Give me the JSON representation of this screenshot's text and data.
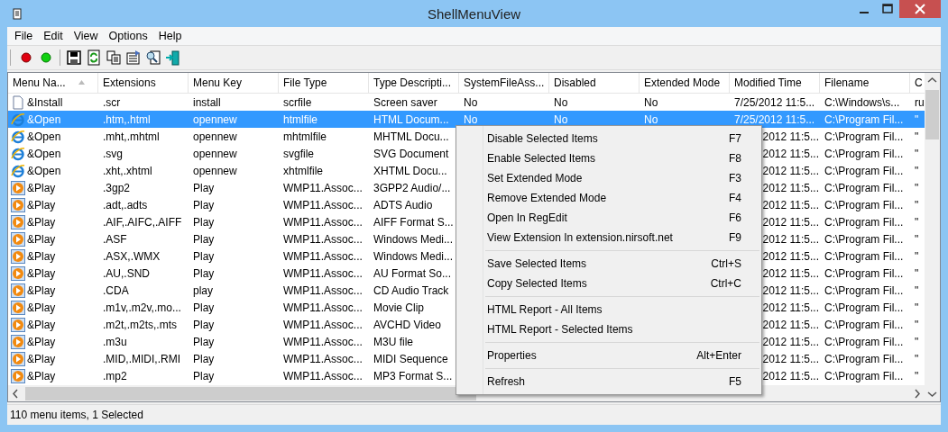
{
  "window": {
    "title": "ShellMenuView"
  },
  "menubar": [
    "File",
    "Edit",
    "View",
    "Options",
    "Help"
  ],
  "columns": [
    {
      "label": "Menu Na...",
      "sorted": true
    },
    {
      "label": "Extensions",
      "sorted": false
    },
    {
      "label": "Menu Key",
      "sorted": false
    },
    {
      "label": "File Type",
      "sorted": false
    },
    {
      "label": "Type Descripti...",
      "sorted": false
    },
    {
      "label": "SystemFileAss...",
      "sorted": false
    },
    {
      "label": "Disabled",
      "sorted": false
    },
    {
      "label": "Extended Mode",
      "sorted": false
    },
    {
      "label": "Modified Time",
      "sorted": false
    },
    {
      "label": "Filename",
      "sorted": false
    },
    {
      "label": "C",
      "sorted": false
    }
  ],
  "rows": [
    {
      "kind": "document",
      "selected": false,
      "name": "&Install",
      "extensions": ".scr",
      "menu_key": "install",
      "file_type": "scrfile",
      "type_description": "Screen saver",
      "system_file_association": "No",
      "disabled": "No",
      "extended_mode": "No",
      "modified_time": "7/25/2012 11:5...",
      "filename": "C:\\Windows\\s...",
      "column_10": "ru"
    },
    {
      "kind": "browser",
      "selected": true,
      "name": "&Open",
      "extensions": ".htm,.html",
      "menu_key": "opennew",
      "file_type": "htmlfile",
      "type_description": "HTML Docum...",
      "system_file_association": "No",
      "disabled": "No",
      "extended_mode": "No",
      "modified_time": "7/25/2012 11:5...",
      "filename": "C:\\Program Fil...",
      "column_10": "\""
    },
    {
      "kind": "browser",
      "selected": false,
      "name": "&Open",
      "extensions": ".mht,.mhtml",
      "menu_key": "opennew",
      "file_type": "mhtmlfile",
      "type_description": "MHTML Docu...",
      "modified_time": "2012 11:5...",
      "filename": "C:\\Program Fil...",
      "column_10": "\""
    },
    {
      "kind": "browser",
      "selected": false,
      "name": "&Open",
      "extensions": ".svg",
      "menu_key": "opennew",
      "file_type": "svgfile",
      "type_description": "SVG Document",
      "modified_time": "2012 11:5...",
      "filename": "C:\\Program Fil...",
      "column_10": "\""
    },
    {
      "kind": "browser",
      "selected": false,
      "name": "&Open",
      "extensions": ".xht,.xhtml",
      "menu_key": "opennew",
      "file_type": "xhtmlfile",
      "type_description": "XHTML Docu...",
      "modified_time": "2012 11:5...",
      "filename": "C:\\Program Fil...",
      "column_10": "\""
    },
    {
      "kind": "play",
      "selected": false,
      "name": "&Play",
      "extensions": ".3gp2",
      "menu_key": "Play",
      "file_type": "WMP11.Assoc...",
      "type_description": "3GPP2 Audio/...",
      "modified_time": "2012 11:5...",
      "filename": "C:\\Program Fil...",
      "column_10": "\""
    },
    {
      "kind": "play",
      "selected": false,
      "name": "&Play",
      "extensions": ".adt,.adts",
      "menu_key": "Play",
      "file_type": "WMP11.Assoc...",
      "type_description": "ADTS Audio",
      "modified_time": "2012 11:5...",
      "filename": "C:\\Program Fil...",
      "column_10": "\""
    },
    {
      "kind": "play",
      "selected": false,
      "name": "&Play",
      "extensions": ".AIF,.AIFC,.AIFF",
      "menu_key": "Play",
      "file_type": "WMP11.Assoc...",
      "type_description": "AIFF Format S...",
      "modified_time": "2012 11:5...",
      "filename": "C:\\Program Fil...",
      "column_10": "\""
    },
    {
      "kind": "play",
      "selected": false,
      "name": "&Play",
      "extensions": ".ASF",
      "menu_key": "Play",
      "file_type": "WMP11.Assoc...",
      "type_description": "Windows Medi...",
      "modified_time": "2012 11:5...",
      "filename": "C:\\Program Fil...",
      "column_10": "\""
    },
    {
      "kind": "play",
      "selected": false,
      "name": "&Play",
      "extensions": ".ASX,.WMX",
      "menu_key": "Play",
      "file_type": "WMP11.Assoc...",
      "type_description": "Windows Medi...",
      "modified_time": "2012 11:5...",
      "filename": "C:\\Program Fil...",
      "column_10": "\""
    },
    {
      "kind": "play",
      "selected": false,
      "name": "&Play",
      "extensions": ".AU,.SND",
      "menu_key": "Play",
      "file_type": "WMP11.Assoc...",
      "type_description": "AU Format So...",
      "modified_time": "2012 11:5...",
      "filename": "C:\\Program Fil...",
      "column_10": "\""
    },
    {
      "kind": "play",
      "selected": false,
      "name": "&Play",
      "extensions": ".CDA",
      "menu_key": "play",
      "file_type": "WMP11.Assoc...",
      "type_description": "CD Audio Track",
      "modified_time": "2012 11:5...",
      "filename": "C:\\Program Fil...",
      "column_10": "\""
    },
    {
      "kind": "play",
      "selected": false,
      "name": "&Play",
      "extensions": ".m1v,.m2v,.mo...",
      "menu_key": "Play",
      "file_type": "WMP11.Assoc...",
      "type_description": "Movie Clip",
      "modified_time": "2012 11:5...",
      "filename": "C:\\Program Fil...",
      "column_10": "\""
    },
    {
      "kind": "play",
      "selected": false,
      "name": "&Play",
      "extensions": ".m2t,.m2ts,.mts",
      "menu_key": "Play",
      "file_type": "WMP11.Assoc...",
      "type_description": "AVCHD Video",
      "modified_time": "2012 11:5...",
      "filename": "C:\\Program Fil...",
      "column_10": "\""
    },
    {
      "kind": "play",
      "selected": false,
      "name": "&Play",
      "extensions": ".m3u",
      "menu_key": "Play",
      "file_type": "WMP11.Assoc...",
      "type_description": "M3U file",
      "modified_time": "2012 11:5...",
      "filename": "C:\\Program Fil...",
      "column_10": "\""
    },
    {
      "kind": "play",
      "selected": false,
      "name": "&Play",
      "extensions": ".MID,.MIDI,.RMI",
      "menu_key": "Play",
      "file_type": "WMP11.Assoc...",
      "type_description": "MIDI Sequence",
      "modified_time": "2012 11:5...",
      "filename": "C:\\Program Fil...",
      "column_10": "\""
    },
    {
      "kind": "play",
      "selected": false,
      "name": "&Play",
      "extensions": ".mp2",
      "menu_key": "Play",
      "file_type": "WMP11.Assoc...",
      "type_description": "MP3 Format S...",
      "modified_time": "2012 11:5...",
      "filename": "C:\\Program Fil...",
      "column_10": "\""
    }
  ],
  "context_menu": [
    [
      {
        "label": "Disable Selected Items",
        "shortcut": "F7"
      },
      {
        "label": "Enable Selected Items",
        "shortcut": "F8"
      },
      {
        "label": "Set Extended Mode",
        "shortcut": "F3"
      },
      {
        "label": "Remove Extended Mode",
        "shortcut": "F4"
      },
      {
        "label": "Open In RegEdit",
        "shortcut": "F6"
      },
      {
        "label": "View Extension In extension.nirsoft.net",
        "shortcut": "F9"
      }
    ],
    [
      {
        "label": "Save Selected Items",
        "shortcut": "Ctrl+S"
      },
      {
        "label": "Copy Selected Items",
        "shortcut": "Ctrl+C"
      }
    ],
    [
      {
        "label": "HTML Report - All Items"
      },
      {
        "label": "HTML Report - Selected Items"
      }
    ],
    [
      {
        "label": "Properties",
        "shortcut": "Alt+Enter"
      }
    ],
    [
      {
        "label": "Refresh",
        "shortcut": "F5"
      }
    ]
  ],
  "status_bar": "110 menu items, 1 Selected"
}
